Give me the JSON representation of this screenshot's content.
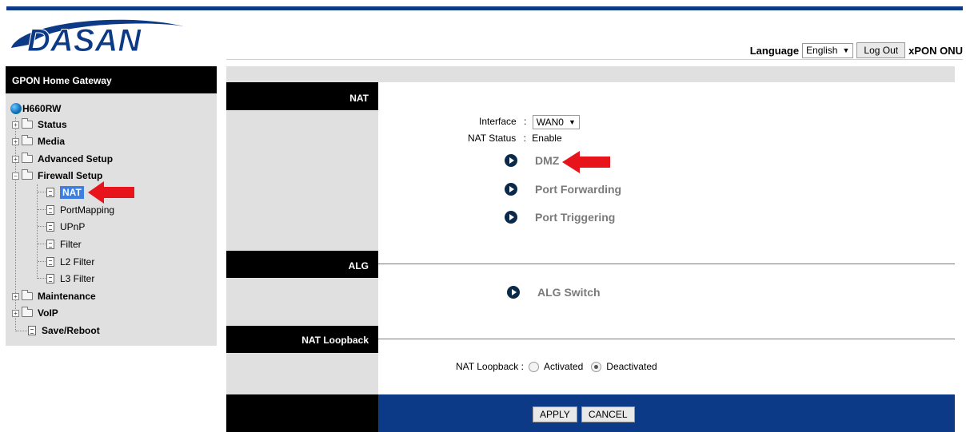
{
  "header": {
    "logo_text": "DASAN",
    "language_label": "Language",
    "language_value": "English",
    "logout_label": "Log Out",
    "product": "xPON ONU"
  },
  "sidebar": {
    "title": "GPON Home Gateway",
    "root": "H660RW",
    "items": [
      {
        "label": "Status"
      },
      {
        "label": "Media"
      },
      {
        "label": "Advanced Setup"
      },
      {
        "label": "Firewall Setup"
      },
      {
        "label": "NAT"
      },
      {
        "label": "PortMapping"
      },
      {
        "label": "UPnP"
      },
      {
        "label": "Filter"
      },
      {
        "label": "L2 Filter"
      },
      {
        "label": "L3 Filter"
      },
      {
        "label": "Maintenance"
      },
      {
        "label": "VoIP"
      },
      {
        "label": "Save/Reboot"
      }
    ]
  },
  "nat": {
    "section_title": "NAT",
    "interface_label": "Interface",
    "interface_value": "WAN0",
    "status_label": "NAT Status",
    "status_value": "Enable",
    "links": [
      "DMZ",
      "Port Forwarding",
      "Port Triggering"
    ]
  },
  "alg": {
    "section_title": "ALG",
    "link": "ALG Switch"
  },
  "loopback": {
    "section_title": "NAT Loopback",
    "label": "NAT Loopback :",
    "option_activated": "Activated",
    "option_deactivated": "Deactivated",
    "selected": "Deactivated"
  },
  "footer": {
    "apply_label": "APPLY",
    "cancel_label": "CANCEL"
  },
  "colors": {
    "brand_blue": "#0c3a86",
    "panel_gray": "#e0e0e0",
    "annotation_red": "#e8141c"
  },
  "glyphs": {
    "colon": ":",
    "dropdown_arrow": "▼",
    "expand": "+",
    "collapse": "−"
  }
}
